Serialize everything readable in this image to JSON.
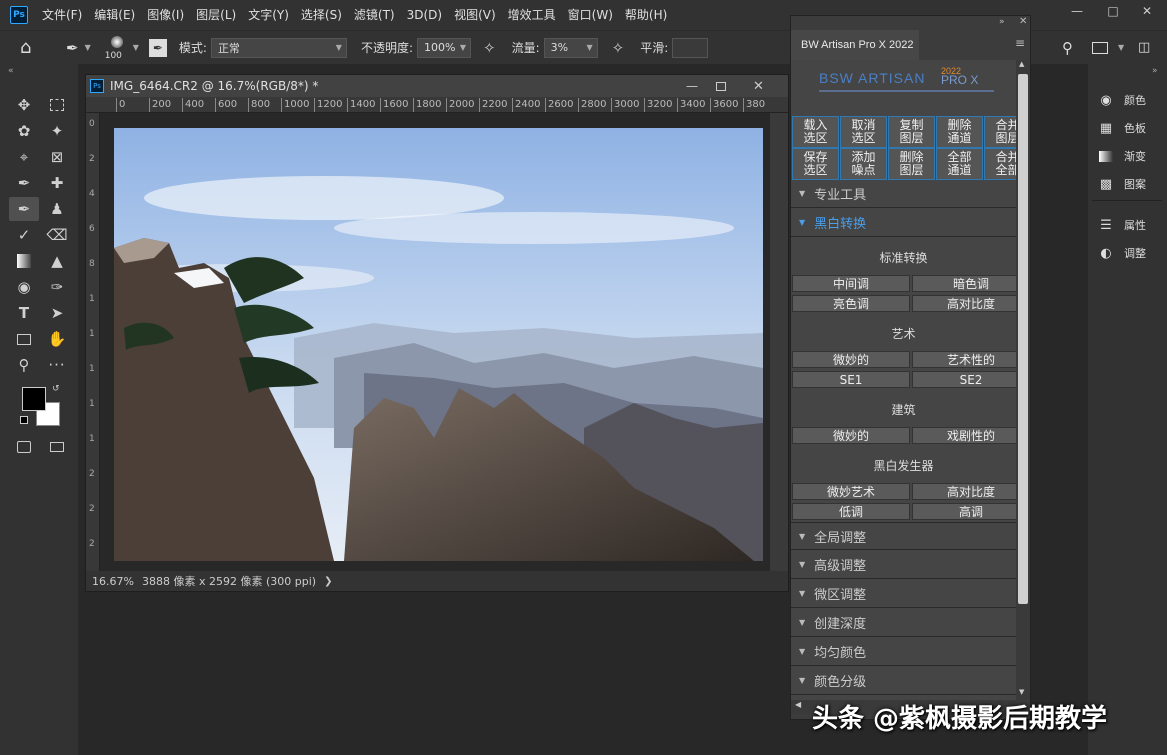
{
  "app": {
    "logo": "Ps"
  },
  "menu": [
    "文件(F)",
    "编辑(E)",
    "图像(I)",
    "图层(L)",
    "文字(Y)",
    "选择(S)",
    "滤镜(T)",
    "3D(D)",
    "视图(V)",
    "增效工具",
    "窗口(W)",
    "帮助(H)"
  ],
  "options": {
    "brush_size": "100",
    "mode_label": "模式:",
    "mode_value": "正常",
    "opacity_label": "不透明度:",
    "opacity_value": "100%",
    "flow_label": "流量:",
    "flow_value": "3%",
    "smooth_label": "平滑:"
  },
  "document": {
    "title": "IMG_6464.CR2 @ 16.7%(RGB/8*) *",
    "ruler_ticks": [
      "0",
      "200",
      "400",
      "600",
      "800",
      "1000",
      "1200",
      "1400",
      "1600",
      "1800",
      "2000",
      "2200",
      "2400",
      "2600",
      "2800",
      "3000",
      "3200",
      "3400",
      "3600",
      "380"
    ],
    "zoom": "16.67%",
    "info": "3888 像素 x 2592 像素 (300 ppi)"
  },
  "plugin": {
    "tab": "BW Artisan Pro X 2022",
    "logo_text": "BSW ARTISAN",
    "logo_suffix": "PRO X",
    "logo_year": "2022",
    "grid_row1": [
      "载入\n选区",
      "取消\n选区",
      "复制\n图层",
      "删除\n通道",
      "合并\n图层"
    ],
    "grid_row2": [
      "保存\n选区",
      "添加\n噪点",
      "删除\n图层",
      "全部\n通道",
      "合并\n全部"
    ],
    "sec_pro": "专业工具",
    "sec_bw": "黑白转换",
    "std_title": "标准转换",
    "std_buttons": [
      "中间调",
      "暗色调",
      "亮色调",
      "高对比度"
    ],
    "art_title": "艺术",
    "art_buttons": [
      "微妙的",
      "艺术性的",
      "SE1",
      "SE2"
    ],
    "arch_title": "建筑",
    "arch_buttons": [
      "微妙的",
      "戏剧性的"
    ],
    "gen_title": "黑白发生器",
    "gen_buttons": [
      "微妙艺术",
      "高对比度",
      "低调",
      "高调"
    ],
    "sections": [
      "全局调整",
      "高级调整",
      "微区调整",
      "创建深度",
      "均匀颜色",
      "颜色分级"
    ]
  },
  "right_panel": [
    "颜色",
    "色板",
    "渐变",
    "图案",
    "属性",
    "调整"
  ],
  "watermark": "头条 @紫枫摄影后期教学",
  "colors": {
    "accent": "#4a9eea",
    "button_border": "#2f78b0"
  }
}
